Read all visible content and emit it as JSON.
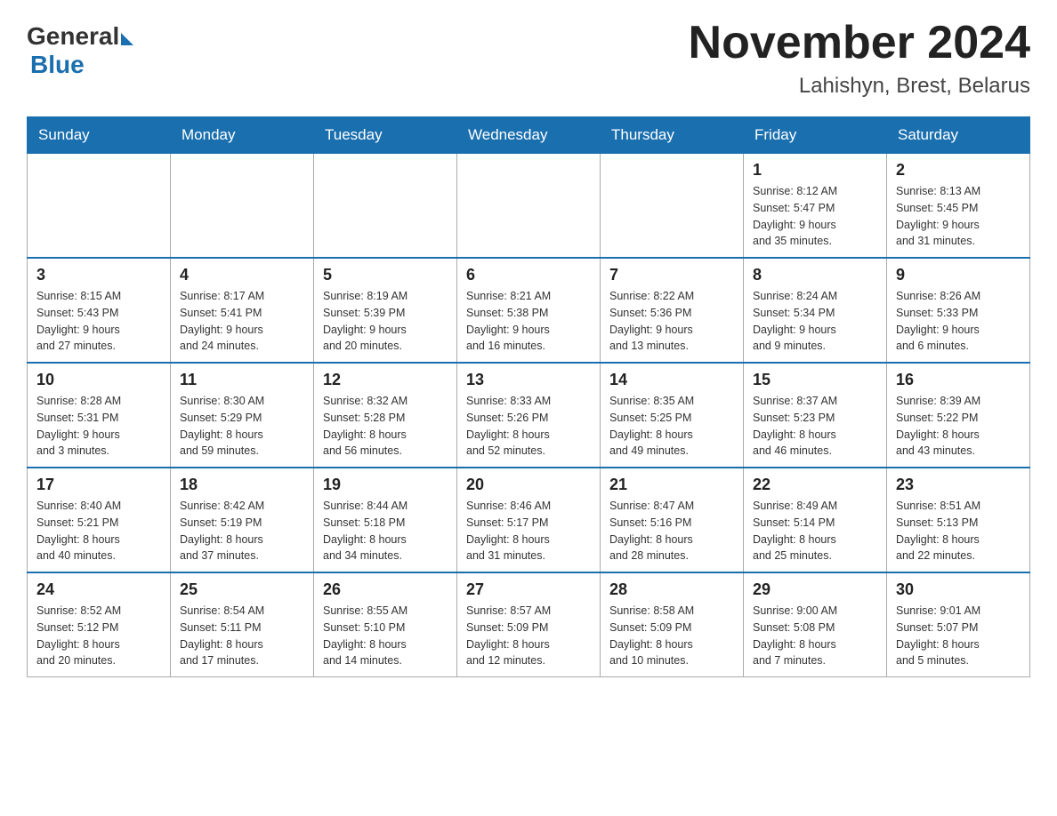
{
  "header": {
    "logo_general": "General",
    "logo_blue": "Blue",
    "title": "November 2024",
    "subtitle": "Lahishyn, Brest, Belarus"
  },
  "days": [
    "Sunday",
    "Monday",
    "Tuesday",
    "Wednesday",
    "Thursday",
    "Friday",
    "Saturday"
  ],
  "weeks": [
    [
      {
        "day": "",
        "info": ""
      },
      {
        "day": "",
        "info": ""
      },
      {
        "day": "",
        "info": ""
      },
      {
        "day": "",
        "info": ""
      },
      {
        "day": "",
        "info": ""
      },
      {
        "day": "1",
        "info": "Sunrise: 8:12 AM\nSunset: 5:47 PM\nDaylight: 9 hours\nand 35 minutes."
      },
      {
        "day": "2",
        "info": "Sunrise: 8:13 AM\nSunset: 5:45 PM\nDaylight: 9 hours\nand 31 minutes."
      }
    ],
    [
      {
        "day": "3",
        "info": "Sunrise: 8:15 AM\nSunset: 5:43 PM\nDaylight: 9 hours\nand 27 minutes."
      },
      {
        "day": "4",
        "info": "Sunrise: 8:17 AM\nSunset: 5:41 PM\nDaylight: 9 hours\nand 24 minutes."
      },
      {
        "day": "5",
        "info": "Sunrise: 8:19 AM\nSunset: 5:39 PM\nDaylight: 9 hours\nand 20 minutes."
      },
      {
        "day": "6",
        "info": "Sunrise: 8:21 AM\nSunset: 5:38 PM\nDaylight: 9 hours\nand 16 minutes."
      },
      {
        "day": "7",
        "info": "Sunrise: 8:22 AM\nSunset: 5:36 PM\nDaylight: 9 hours\nand 13 minutes."
      },
      {
        "day": "8",
        "info": "Sunrise: 8:24 AM\nSunset: 5:34 PM\nDaylight: 9 hours\nand 9 minutes."
      },
      {
        "day": "9",
        "info": "Sunrise: 8:26 AM\nSunset: 5:33 PM\nDaylight: 9 hours\nand 6 minutes."
      }
    ],
    [
      {
        "day": "10",
        "info": "Sunrise: 8:28 AM\nSunset: 5:31 PM\nDaylight: 9 hours\nand 3 minutes."
      },
      {
        "day": "11",
        "info": "Sunrise: 8:30 AM\nSunset: 5:29 PM\nDaylight: 8 hours\nand 59 minutes."
      },
      {
        "day": "12",
        "info": "Sunrise: 8:32 AM\nSunset: 5:28 PM\nDaylight: 8 hours\nand 56 minutes."
      },
      {
        "day": "13",
        "info": "Sunrise: 8:33 AM\nSunset: 5:26 PM\nDaylight: 8 hours\nand 52 minutes."
      },
      {
        "day": "14",
        "info": "Sunrise: 8:35 AM\nSunset: 5:25 PM\nDaylight: 8 hours\nand 49 minutes."
      },
      {
        "day": "15",
        "info": "Sunrise: 8:37 AM\nSunset: 5:23 PM\nDaylight: 8 hours\nand 46 minutes."
      },
      {
        "day": "16",
        "info": "Sunrise: 8:39 AM\nSunset: 5:22 PM\nDaylight: 8 hours\nand 43 minutes."
      }
    ],
    [
      {
        "day": "17",
        "info": "Sunrise: 8:40 AM\nSunset: 5:21 PM\nDaylight: 8 hours\nand 40 minutes."
      },
      {
        "day": "18",
        "info": "Sunrise: 8:42 AM\nSunset: 5:19 PM\nDaylight: 8 hours\nand 37 minutes."
      },
      {
        "day": "19",
        "info": "Sunrise: 8:44 AM\nSunset: 5:18 PM\nDaylight: 8 hours\nand 34 minutes."
      },
      {
        "day": "20",
        "info": "Sunrise: 8:46 AM\nSunset: 5:17 PM\nDaylight: 8 hours\nand 31 minutes."
      },
      {
        "day": "21",
        "info": "Sunrise: 8:47 AM\nSunset: 5:16 PM\nDaylight: 8 hours\nand 28 minutes."
      },
      {
        "day": "22",
        "info": "Sunrise: 8:49 AM\nSunset: 5:14 PM\nDaylight: 8 hours\nand 25 minutes."
      },
      {
        "day": "23",
        "info": "Sunrise: 8:51 AM\nSunset: 5:13 PM\nDaylight: 8 hours\nand 22 minutes."
      }
    ],
    [
      {
        "day": "24",
        "info": "Sunrise: 8:52 AM\nSunset: 5:12 PM\nDaylight: 8 hours\nand 20 minutes."
      },
      {
        "day": "25",
        "info": "Sunrise: 8:54 AM\nSunset: 5:11 PM\nDaylight: 8 hours\nand 17 minutes."
      },
      {
        "day": "26",
        "info": "Sunrise: 8:55 AM\nSunset: 5:10 PM\nDaylight: 8 hours\nand 14 minutes."
      },
      {
        "day": "27",
        "info": "Sunrise: 8:57 AM\nSunset: 5:09 PM\nDaylight: 8 hours\nand 12 minutes."
      },
      {
        "day": "28",
        "info": "Sunrise: 8:58 AM\nSunset: 5:09 PM\nDaylight: 8 hours\nand 10 minutes."
      },
      {
        "day": "29",
        "info": "Sunrise: 9:00 AM\nSunset: 5:08 PM\nDaylight: 8 hours\nand 7 minutes."
      },
      {
        "day": "30",
        "info": "Sunrise: 9:01 AM\nSunset: 5:07 PM\nDaylight: 8 hours\nand 5 minutes."
      }
    ]
  ]
}
